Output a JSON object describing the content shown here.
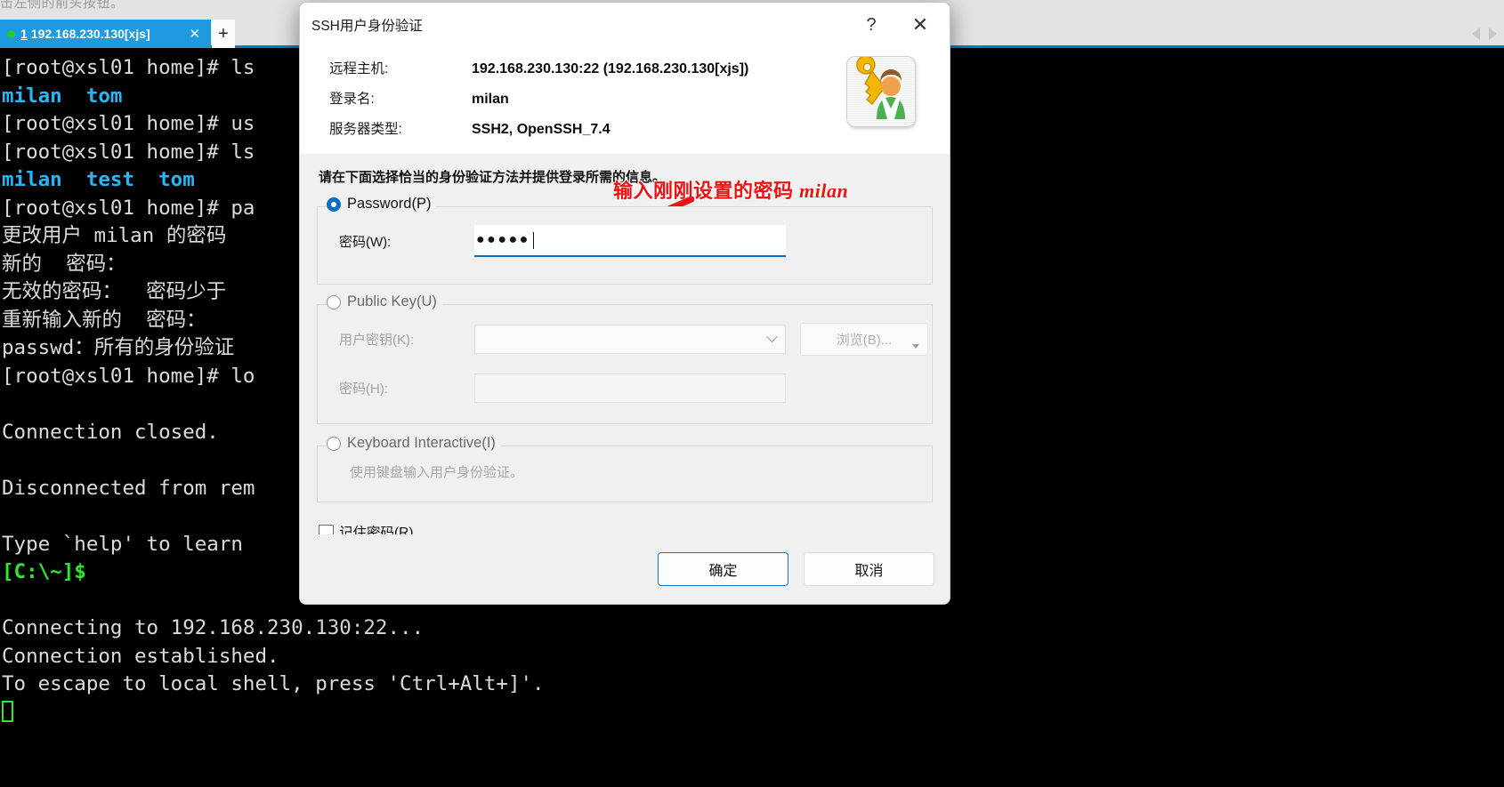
{
  "top_hint": "击左侧的前头按钮。",
  "tabbar": {
    "tab_number": "1",
    "tab_title": "192.168.230.130[xjs]",
    "close_label": "✕",
    "newtab_label": "+",
    "scroll_left_icon": "caret-left-icon",
    "scroll_right_icon": "caret-right-icon"
  },
  "terminal": {
    "lines": [
      {
        "text": "[root@xsl01 home]# ls",
        "color": "white"
      },
      {
        "text": "milan  tom",
        "color": "cyan"
      },
      {
        "text": "[root@xsl01 home]# us",
        "color": "white"
      },
      {
        "text": "[root@xsl01 home]# ls",
        "color": "white"
      },
      {
        "text": "milan  test  tom",
        "color": "cyan"
      },
      {
        "text": "[root@xsl01 home]# pa",
        "color": "white"
      },
      {
        "text": "更改用户 milan 的密码",
        "color": "white"
      },
      {
        "text": "新的  密码：",
        "color": "white"
      },
      {
        "text": "无效的密码：  密码少于",
        "color": "white"
      },
      {
        "text": "重新输入新的  密码：",
        "color": "white"
      },
      {
        "text": "passwd：所有的身份验证",
        "color": "white"
      },
      {
        "text": "[root@xsl01 home]# lo",
        "color": "white"
      },
      {
        "text": "",
        "color": "white"
      },
      {
        "text": "Connection closed.",
        "color": "white"
      },
      {
        "text": "",
        "color": "white"
      },
      {
        "text": "Disconnected from rem",
        "color": "white"
      },
      {
        "text": "",
        "color": "white"
      },
      {
        "text": "Type `help' to learn ",
        "color": "white"
      },
      {
        "text": "[C:\\~]$",
        "color": "green"
      },
      {
        "text": "",
        "color": "white"
      },
      {
        "text": "Connecting to 192.168.230.130:22...",
        "color": "white"
      },
      {
        "text": "Connection established.",
        "color": "white"
      },
      {
        "text": "To escape to local shell, press 'Ctrl+Alt+]'.",
        "color": "white"
      }
    ]
  },
  "dialog": {
    "title": "SSH用户身份验证",
    "help_label": "?",
    "close_label": "✕",
    "icon_name": "key-user-icon",
    "info": [
      {
        "label": "远程主机:",
        "value": "192.168.230.130:22 (192.168.230.130[xjs])"
      },
      {
        "label": "登录名:",
        "value": "milan"
      },
      {
        "label": "服务器类型:",
        "value": "SSH2, OpenSSH_7.4"
      }
    ],
    "prompt": "请在下面选择恰当的身份验证方法并提供登录所需的信息。",
    "annotation": {
      "text_cjk": "输入刚刚设置的密码 ",
      "text_latin": "milan",
      "color": "#ee1111"
    },
    "password_group": {
      "legend": "Password(P)",
      "selected": true,
      "field_label": "密码(W):",
      "value_masked": "●●●●●",
      "value_length": 5
    },
    "publickey_group": {
      "legend": "Public Key(U)",
      "selected": false,
      "key_label": "用户密钥(K):",
      "key_value": "",
      "passphrase_label": "密码(H):",
      "passphrase_value": "",
      "browse_label": "浏览(B)..."
    },
    "keyboard_group": {
      "legend": "Keyboard Interactive(I)",
      "selected": false,
      "description": "使用键盘输入用户身份验证。"
    },
    "remember": {
      "label": "记住密码(R)",
      "checked": false
    },
    "buttons": {
      "ok": "确定",
      "cancel": "取消"
    }
  },
  "colors": {
    "accent_blue": "#0a78c8",
    "tab_blue": "#1f9ae0",
    "terminal_cyan": "#29b6f6",
    "terminal_green": "#2bea2b",
    "annotation_red": "#ee1111"
  }
}
